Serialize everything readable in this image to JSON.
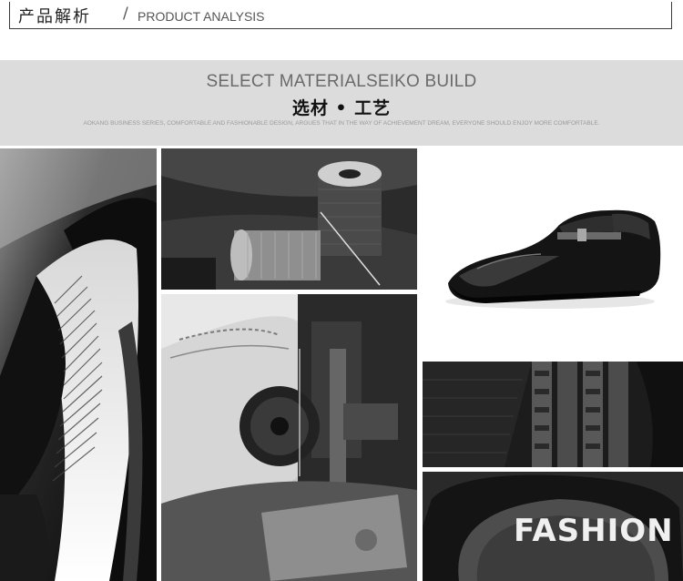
{
  "header": {
    "title_cn": "产品解析",
    "separator": "/",
    "title_en": "PRODUCT ANALYSIS"
  },
  "banner": {
    "heading_en": "SELECT MATERIALSEIKO BUILD",
    "heading_cn": "选材 • 工艺",
    "description": "AOKANG BUSINESS SERIES, COMFORTABLE AND FASHIONABLE DESIGN, ARGUES THAT IN THE WAY OF ACHIEVEMENT DREAM, EVERYONE SHOULD ENJOY MORE COMFORTABLE."
  },
  "photos": {
    "insole_text": "FASHION"
  }
}
